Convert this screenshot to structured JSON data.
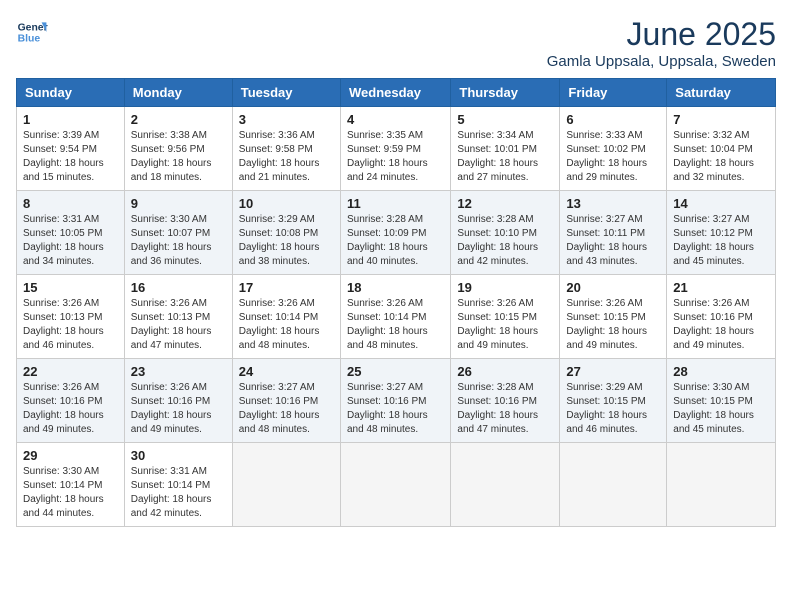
{
  "logo": {
    "line1": "General",
    "line2": "Blue"
  },
  "title": "June 2025",
  "location": "Gamla Uppsala, Uppsala, Sweden",
  "days_of_week": [
    "Sunday",
    "Monday",
    "Tuesday",
    "Wednesday",
    "Thursday",
    "Friday",
    "Saturday"
  ],
  "weeks": [
    [
      {
        "day": "1",
        "sunrise": "3:39 AM",
        "sunset": "9:54 PM",
        "daylight": "18 hours and 15 minutes."
      },
      {
        "day": "2",
        "sunrise": "3:38 AM",
        "sunset": "9:56 PM",
        "daylight": "18 hours and 18 minutes."
      },
      {
        "day": "3",
        "sunrise": "3:36 AM",
        "sunset": "9:58 PM",
        "daylight": "18 hours and 21 minutes."
      },
      {
        "day": "4",
        "sunrise": "3:35 AM",
        "sunset": "9:59 PM",
        "daylight": "18 hours and 24 minutes."
      },
      {
        "day": "5",
        "sunrise": "3:34 AM",
        "sunset": "10:01 PM",
        "daylight": "18 hours and 27 minutes."
      },
      {
        "day": "6",
        "sunrise": "3:33 AM",
        "sunset": "10:02 PM",
        "daylight": "18 hours and 29 minutes."
      },
      {
        "day": "7",
        "sunrise": "3:32 AM",
        "sunset": "10:04 PM",
        "daylight": "18 hours and 32 minutes."
      }
    ],
    [
      {
        "day": "8",
        "sunrise": "3:31 AM",
        "sunset": "10:05 PM",
        "daylight": "18 hours and 34 minutes."
      },
      {
        "day": "9",
        "sunrise": "3:30 AM",
        "sunset": "10:07 PM",
        "daylight": "18 hours and 36 minutes."
      },
      {
        "day": "10",
        "sunrise": "3:29 AM",
        "sunset": "10:08 PM",
        "daylight": "18 hours and 38 minutes."
      },
      {
        "day": "11",
        "sunrise": "3:28 AM",
        "sunset": "10:09 PM",
        "daylight": "18 hours and 40 minutes."
      },
      {
        "day": "12",
        "sunrise": "3:28 AM",
        "sunset": "10:10 PM",
        "daylight": "18 hours and 42 minutes."
      },
      {
        "day": "13",
        "sunrise": "3:27 AM",
        "sunset": "10:11 PM",
        "daylight": "18 hours and 43 minutes."
      },
      {
        "day": "14",
        "sunrise": "3:27 AM",
        "sunset": "10:12 PM",
        "daylight": "18 hours and 45 minutes."
      }
    ],
    [
      {
        "day": "15",
        "sunrise": "3:26 AM",
        "sunset": "10:13 PM",
        "daylight": "18 hours and 46 minutes."
      },
      {
        "day": "16",
        "sunrise": "3:26 AM",
        "sunset": "10:13 PM",
        "daylight": "18 hours and 47 minutes."
      },
      {
        "day": "17",
        "sunrise": "3:26 AM",
        "sunset": "10:14 PM",
        "daylight": "18 hours and 48 minutes."
      },
      {
        "day": "18",
        "sunrise": "3:26 AM",
        "sunset": "10:14 PM",
        "daylight": "18 hours and 48 minutes."
      },
      {
        "day": "19",
        "sunrise": "3:26 AM",
        "sunset": "10:15 PM",
        "daylight": "18 hours and 49 minutes."
      },
      {
        "day": "20",
        "sunrise": "3:26 AM",
        "sunset": "10:15 PM",
        "daylight": "18 hours and 49 minutes."
      },
      {
        "day": "21",
        "sunrise": "3:26 AM",
        "sunset": "10:16 PM",
        "daylight": "18 hours and 49 minutes."
      }
    ],
    [
      {
        "day": "22",
        "sunrise": "3:26 AM",
        "sunset": "10:16 PM",
        "daylight": "18 hours and 49 minutes."
      },
      {
        "day": "23",
        "sunrise": "3:26 AM",
        "sunset": "10:16 PM",
        "daylight": "18 hours and 49 minutes."
      },
      {
        "day": "24",
        "sunrise": "3:27 AM",
        "sunset": "10:16 PM",
        "daylight": "18 hours and 48 minutes."
      },
      {
        "day": "25",
        "sunrise": "3:27 AM",
        "sunset": "10:16 PM",
        "daylight": "18 hours and 48 minutes."
      },
      {
        "day": "26",
        "sunrise": "3:28 AM",
        "sunset": "10:16 PM",
        "daylight": "18 hours and 47 minutes."
      },
      {
        "day": "27",
        "sunrise": "3:29 AM",
        "sunset": "10:15 PM",
        "daylight": "18 hours and 46 minutes."
      },
      {
        "day": "28",
        "sunrise": "3:30 AM",
        "sunset": "10:15 PM",
        "daylight": "18 hours and 45 minutes."
      }
    ],
    [
      {
        "day": "29",
        "sunrise": "3:30 AM",
        "sunset": "10:14 PM",
        "daylight": "18 hours and 44 minutes."
      },
      {
        "day": "30",
        "sunrise": "3:31 AM",
        "sunset": "10:14 PM",
        "daylight": "18 hours and 42 minutes."
      },
      null,
      null,
      null,
      null,
      null
    ]
  ]
}
